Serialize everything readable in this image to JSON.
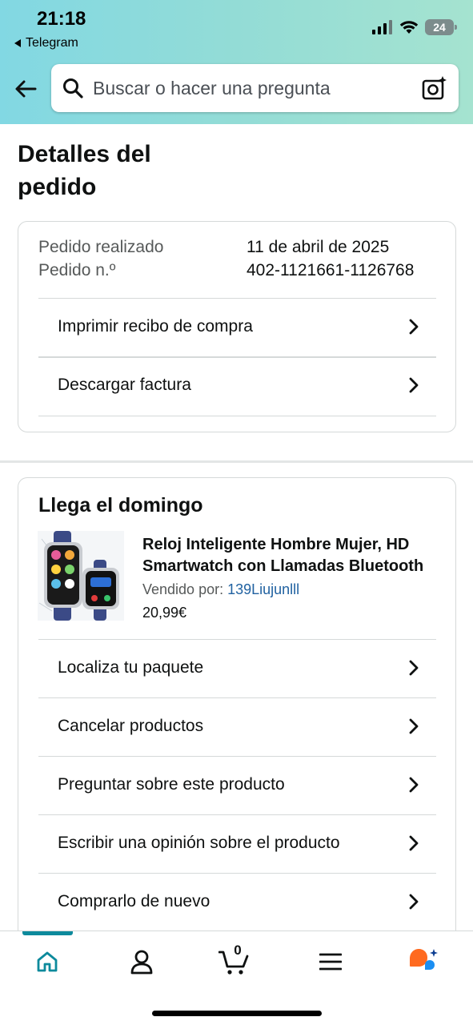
{
  "status_bar": {
    "time": "21:18",
    "back_app": "Telegram",
    "battery": "24"
  },
  "search": {
    "placeholder": "Buscar o hacer una pregunta"
  },
  "page": {
    "title": "Detalles del pedido"
  },
  "order_info": {
    "placed_label": "Pedido realizado",
    "placed_value": "11 de abril de 2025",
    "number_label": "Pedido n.º",
    "number_value": "402-1121661-1126768"
  },
  "order_actions": [
    {
      "label": "Imprimir recibo de compra"
    },
    {
      "label": "Descargar factura"
    }
  ],
  "shipment": {
    "title": "Llega el domingo",
    "product": {
      "title_line1": "Reloj Inteligente Hombre Mujer, HD",
      "title_line2": "Smartwatch con Llamadas Bluetooth",
      "sold_by_label": "Vendido por:",
      "seller": "139Liujunlll",
      "price": "20,99€"
    },
    "actions": [
      {
        "label": "Localiza tu paquete"
      },
      {
        "label": "Cancelar productos"
      },
      {
        "label": "Preguntar sobre este producto"
      },
      {
        "label": "Escribir una opinión sobre el producto"
      },
      {
        "label": "Comprarlo de nuevo"
      }
    ]
  },
  "bottom_nav": {
    "items": [
      "home-icon",
      "account-icon",
      "cart-icon",
      "menu-icon",
      "rufus-ai-icon"
    ],
    "cart_count": "0",
    "accent_color": "#0d8a9c"
  }
}
